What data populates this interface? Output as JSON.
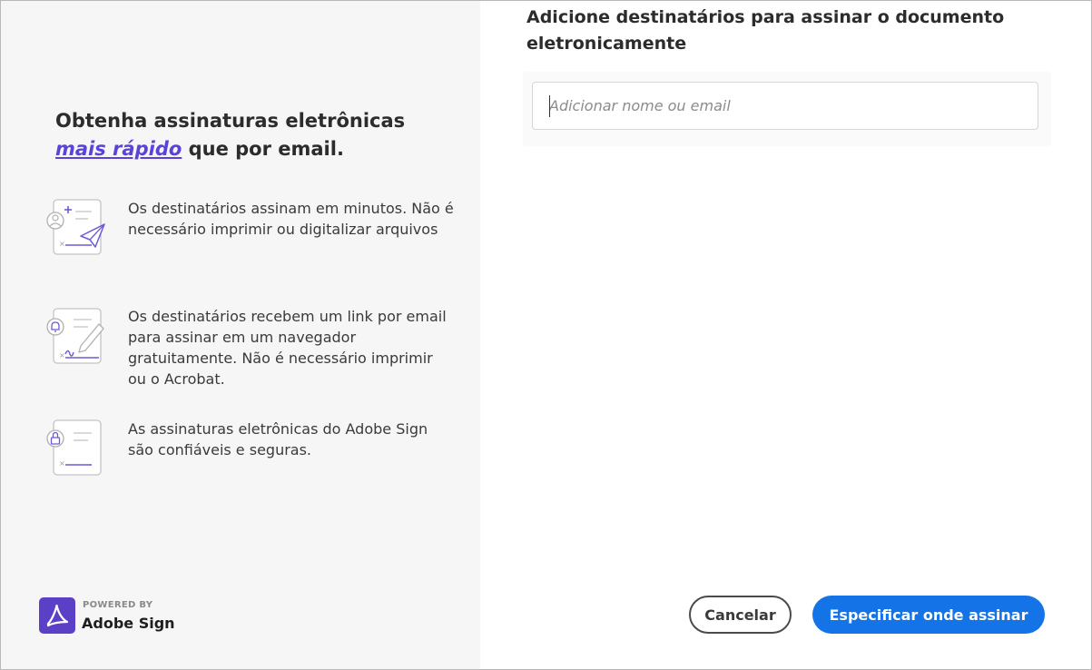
{
  "left_panel": {
    "headline_part1": "Obtenha assinaturas eletrônicas",
    "headline_accent": "mais rápido",
    "headline_part2": " que por email.",
    "features": [
      {
        "icon": "send-document-icon",
        "text": "Os destinatários assinam em minutos. Não é necessário imprimir ou digitalizar arquivos"
      },
      {
        "icon": "sign-document-icon",
        "text": "Os destinatários recebem um link por email para assinar em um navegador gratuitamente. Não é necessário imprimir ou o Acrobat."
      },
      {
        "icon": "secure-document-icon",
        "text": "As assinaturas eletrônicas do Adobe Sign são confiáveis e seguras."
      }
    ],
    "powered_by": "POWERED BY",
    "brand": "Adobe Sign"
  },
  "dialog": {
    "title": "Adicione destinatários para assinar o documento eletronicamente",
    "recipient_input": {
      "placeholder": "Adicionar nome ou email",
      "value": ""
    },
    "cancel_label": "Cancelar",
    "primary_label": "Especificar onde assinar"
  },
  "colors": {
    "accent": "#5a44d6",
    "primary_button": "#1473e6",
    "adobe_logo": "#5b3fc7",
    "left_panel_bg": "#f6f6f6"
  }
}
